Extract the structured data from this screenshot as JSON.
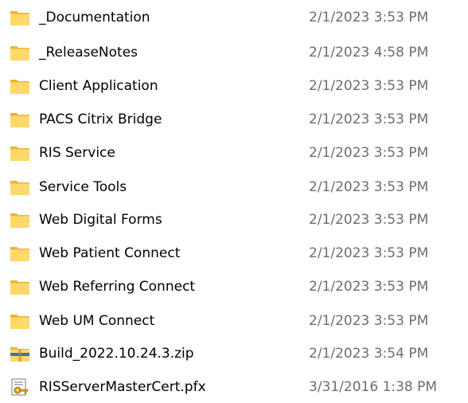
{
  "files": [
    {
      "name": "_Documentation",
      "modified": "2/1/2023 3:53 PM",
      "icon": "folder-icon"
    },
    {
      "name": "_ReleaseNotes",
      "modified": "2/1/2023 4:58 PM",
      "icon": "folder-icon"
    },
    {
      "name": "Client Application",
      "modified": "2/1/2023 3:53 PM",
      "icon": "folder-icon"
    },
    {
      "name": "PACS Citrix Bridge",
      "modified": "2/1/2023 3:53 PM",
      "icon": "folder-icon"
    },
    {
      "name": "RIS Service",
      "modified": "2/1/2023 3:53 PM",
      "icon": "folder-icon"
    },
    {
      "name": "Service Tools",
      "modified": "2/1/2023 3:53 PM",
      "icon": "folder-icon"
    },
    {
      "name": "Web Digital Forms",
      "modified": "2/1/2023 3:53 PM",
      "icon": "folder-icon"
    },
    {
      "name": "Web Patient Connect",
      "modified": "2/1/2023 3:53 PM",
      "icon": "folder-icon"
    },
    {
      "name": "Web Referring Connect",
      "modified": "2/1/2023 3:53 PM",
      "icon": "folder-icon"
    },
    {
      "name": "Web UM Connect",
      "modified": "2/1/2023 3:53 PM",
      "icon": "folder-icon"
    },
    {
      "name": "Build_2022.10.24.3.zip",
      "modified": "2/1/2023 3:54 PM",
      "icon": "zip-archive-icon"
    },
    {
      "name": "RISServerMasterCert.pfx",
      "modified": "3/31/2016 1:38 PM",
      "icon": "certificate-key-icon"
    }
  ],
  "colors": {
    "folder_body": "#ffd86b",
    "folder_back": "#e8b43a",
    "date_text": "#6d6d6d",
    "name_text": "#000000"
  }
}
